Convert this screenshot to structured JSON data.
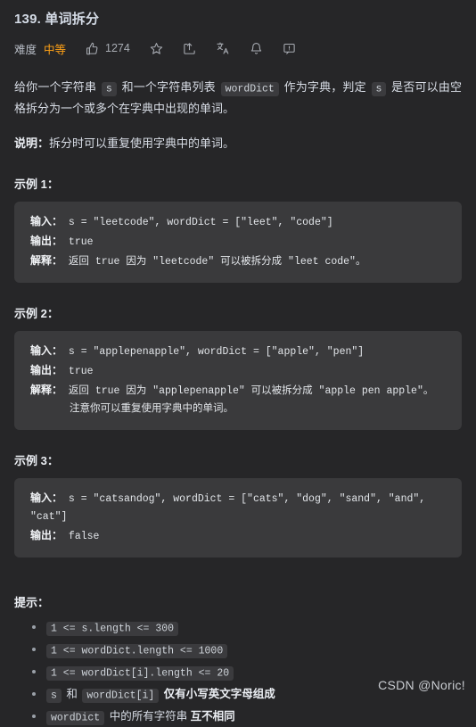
{
  "header": {
    "title": "139. 单词拆分",
    "difficulty_label": "难度",
    "difficulty_value": "中等",
    "difficulty_color": "#ffa116",
    "like_count": "1274",
    "icons": [
      "thumbs-up-icon",
      "star-icon",
      "share-icon",
      "translate-icon",
      "bell-icon",
      "feedback-icon"
    ]
  },
  "description": {
    "p1_a": "给你一个字符串 ",
    "p1_code1": "s",
    "p1_b": " 和一个字符串列表 ",
    "p1_code2": "wordDict",
    "p1_c": " 作为字典，判定 ",
    "p1_code3": "s",
    "p1_d": " 是否可以由空格拆分为一个或多个在字典中出现的单词。",
    "note_label": "说明：",
    "note_text": "拆分时可以重复使用字典中的单词。"
  },
  "examples": [
    {
      "title": "示例 1：",
      "input_label": "输入：",
      "input_value": " s = \"leetcode\", wordDict = [\"leet\", \"code\"]",
      "output_label": "输出：",
      "output_value": " true",
      "explain_label": "解释：",
      "explain_value": " 返回 true 因为 \"leetcode\" 可以被拆分成 \"leet code\"。",
      "extra": ""
    },
    {
      "title": "示例 2：",
      "input_label": "输入：",
      "input_value": " s = \"applepenapple\", wordDict = [\"apple\", \"pen\"]",
      "output_label": "输出：",
      "output_value": " true",
      "explain_label": "解释：",
      "explain_value": " 返回 true 因为 \"applepenapple\" 可以被拆分成 \"apple pen apple\"。",
      "extra": "注意你可以重复使用字典中的单词。"
    },
    {
      "title": "示例 3：",
      "input_label": "输入：",
      "input_value": " s = \"catsandog\", wordDict = [\"cats\", \"dog\", \"sand\", \"and\", \"cat\"]",
      "output_label": "输出：",
      "output_value": " false",
      "explain_label": "",
      "explain_value": "",
      "extra": ""
    }
  ],
  "tips": {
    "title": "提示：",
    "items": [
      {
        "code": "1 <= s.length <= 300",
        "text": ""
      },
      {
        "code": "1 <= wordDict.length <= 1000",
        "text": ""
      },
      {
        "code": "1 <= wordDict[i].length <= 20",
        "text": ""
      },
      {
        "code": "s",
        "mid": " 和 ",
        "code2": "wordDict[i]",
        "text": " 仅有小写英文字母组成"
      },
      {
        "code": "wordDict",
        "text2a": " 中的所有字符串 ",
        "text2b": "互不相同"
      }
    ]
  },
  "watermark": "CSDN @Noric!"
}
